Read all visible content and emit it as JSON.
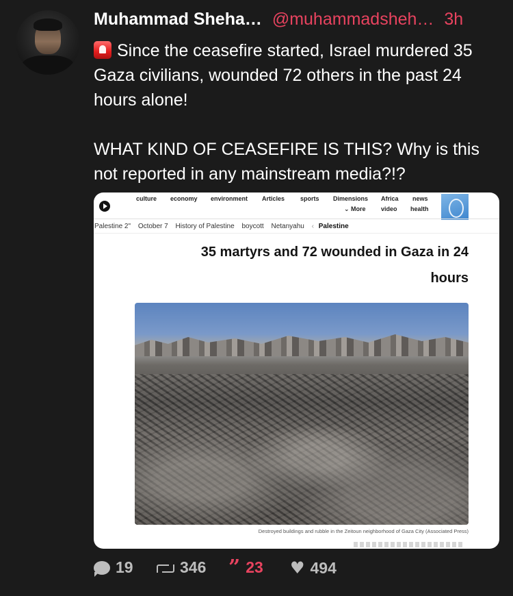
{
  "tweet": {
    "author_name": "Muhammad Sheha…",
    "handle": "@muhammadsheh…",
    "time": "3h",
    "paragraph1": "Since the ceasefire started, Israel murdered 35 Gaza civilians, wounded 72 others in the past 24 hours alone!",
    "paragraph2": "WHAT KIND OF CEASEFIRE IS THIS? Why is this not reported in any mainstream media?!?",
    "siren_icon": "police-car-light-emoji"
  },
  "embed": {
    "nav": [
      "culture",
      "economy",
      "environment",
      "Articles",
      "sports",
      "Dimensions",
      "Africa",
      "news",
      "More",
      "video",
      "health"
    ],
    "breadcrumbs": [
      "Palestine 2\"",
      "October 7",
      "History of Palestine",
      "boycott",
      "Netanyahu"
    ],
    "breadcrumb_active": "Palestine",
    "headline_line1": "35 martyrs and 72 wounded in Gaza in 24",
    "headline_line2": "hours",
    "caption": "Destroyed buildings and rubble in the Zeitoun neighborhood of Gaza City (Associated Press)"
  },
  "actions": {
    "replies": "19",
    "retweets": "346",
    "quotes": "23",
    "likes": "494"
  },
  "colors": {
    "background": "#1b1b1b",
    "accent": "#e8435f",
    "muted": "#bdbdbd"
  }
}
